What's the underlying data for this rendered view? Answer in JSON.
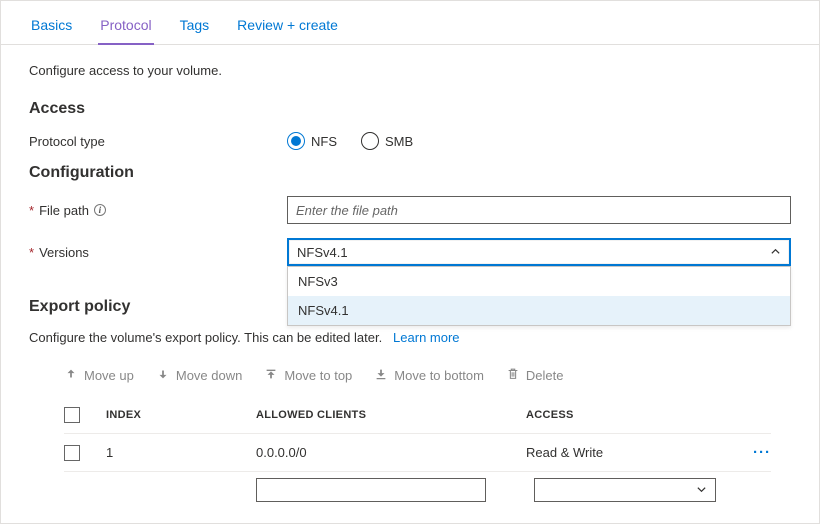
{
  "tabs": {
    "basics": "Basics",
    "protocol": "Protocol",
    "tags": "Tags",
    "review": "Review + create"
  },
  "desc": "Configure access to your volume.",
  "sections": {
    "access": "Access",
    "configuration": "Configuration",
    "export_policy": "Export policy"
  },
  "labels": {
    "protocol_type": "Protocol type",
    "file_path": "File path",
    "versions": "Versions"
  },
  "protocol_options": {
    "nfs": "NFS",
    "smb": "SMB"
  },
  "file_path_placeholder": "Enter the file path",
  "version_selected": "NFSv4.1",
  "version_options": [
    "NFSv3",
    "NFSv4.1"
  ],
  "export_desc": "Configure the volume's export policy. This can be edited later.",
  "learn_more": "Learn more",
  "toolbar": {
    "move_up": "Move up",
    "move_down": "Move down",
    "move_top": "Move to top",
    "move_bottom": "Move to bottom",
    "delete": "Delete"
  },
  "table": {
    "headers": {
      "index": "Index",
      "allowed": "Allowed Clients",
      "access": "Access"
    },
    "rows": [
      {
        "index": "1",
        "allowed": "0.0.0.0/0",
        "access": "Read & Write"
      }
    ]
  }
}
